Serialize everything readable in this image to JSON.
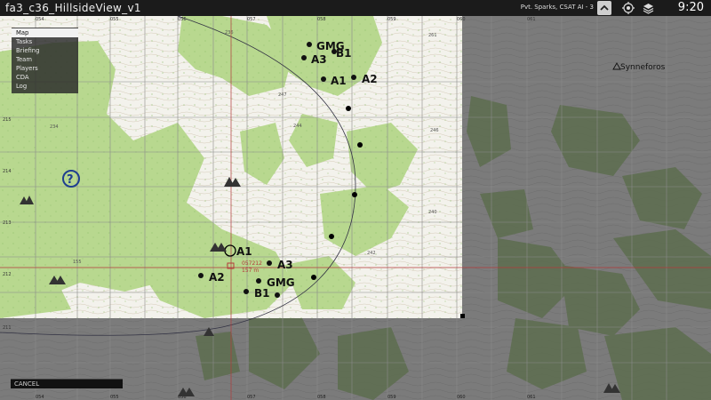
{
  "window": {
    "title": "fa3_c36_HillsideView_v1",
    "player_info": "Pvt. Sparks, CSAT AI - 3",
    "clock": "9:20"
  },
  "menu": {
    "items": [
      "Map",
      "Tasks",
      "Briefing",
      "Team",
      "Players",
      "CDA",
      "Log"
    ],
    "active": "Map"
  },
  "map": {
    "top_grid_labels": [
      "054",
      "055",
      "056",
      "057",
      "058",
      "059",
      "060",
      "061"
    ],
    "bottom_grid_labels": [
      "054",
      "055",
      "056",
      "057",
      "058",
      "059",
      "060",
      "061"
    ],
    "left_grid_labels": [
      "215",
      "214",
      "213",
      "212",
      "211"
    ],
    "town_label": "Synneforos",
    "cursor_coord": "057212",
    "cursor_distance": "157 m",
    "unit_markers_north": [
      "GMG",
      "B1",
      "A3",
      "A1",
      "A2"
    ],
    "unit_markers_south": [
      "A1",
      "A3",
      "A2",
      "GMG",
      "B1"
    ],
    "elevation_labels": [
      "247",
      "244",
      "246",
      "240",
      "234",
      "155",
      "242",
      "236",
      "261"
    ]
  },
  "footer": {
    "cancel_label": "CANCEL"
  },
  "colors": {
    "topbar": "#1b1b1b",
    "forest": "#b8d88f",
    "paper": "#f3f2ec",
    "fog": "#7d7d7d",
    "marker": "#000000",
    "cursor_line": "#b33a3a"
  }
}
